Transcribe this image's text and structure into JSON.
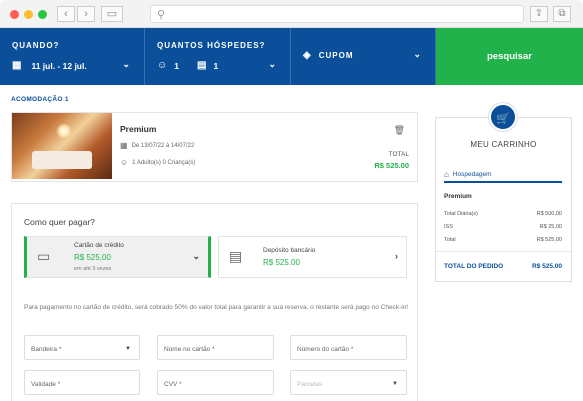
{
  "search": {
    "when_label": "QUANDO?",
    "dates": "11 jul. - 12 jul.",
    "guests_label": "QUANTOS HÓSPEDES?",
    "adults": "1",
    "children": "1",
    "coupon_label": "CUPOM",
    "search_button": "pesquisar"
  },
  "booking": {
    "section_label": "ACOMODAÇÃO 1",
    "room_name": "Premium",
    "dates": "De 13/07/22 à 14/07/22",
    "guests": "1 Adulto(s) 0 Criança(s)",
    "total_label": "TOTAL",
    "total_value": "R$ 525.00"
  },
  "cart": {
    "title": "MEU CARRINHO",
    "tab": "Hospedagem",
    "item": "Premium",
    "rows": [
      {
        "label": "Total Diária(s)",
        "value": "R$ 500,00"
      },
      {
        "label": "ISS",
        "value": "R$ 25,00"
      },
      {
        "label": "Total",
        "value": "R$ 525,00"
      }
    ],
    "order_total_label": "TOTAL DO PEDIDO",
    "order_total_value": "R$ 525.00"
  },
  "payment": {
    "question": "Como quer pagar?",
    "credit": {
      "name": "Cartão de crédito",
      "value": "R$ 525,00",
      "sub": "em até 3 vezes"
    },
    "bank": {
      "name": "Depósito bancário",
      "value": "R$ 525.00"
    },
    "note": "Para pagamento no cartão de crédito, será cobrado 50% do valor total para garantir a sua reserva, o restante será pago no Check-in!",
    "fields": {
      "brand": "Bandeira *",
      "card_name": "Nome no cartão *",
      "card_number": "Número do cartão *",
      "expiry": "Validade *",
      "cvv": "CVV *",
      "installments": "Parcelas"
    }
  },
  "colors": {
    "primary": "#0b4f9a",
    "accent": "#22b24c"
  }
}
